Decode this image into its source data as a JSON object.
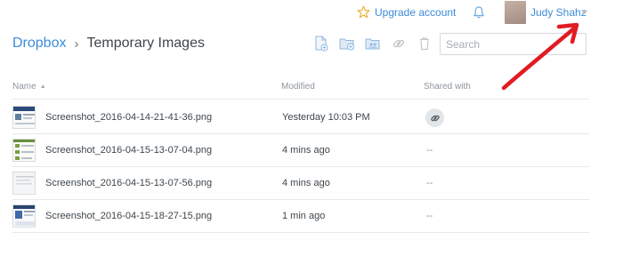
{
  "topbar": {
    "upgrade_label": "Upgrade account",
    "user_name": "Judy Shahz"
  },
  "breadcrumb": {
    "root": "Dropbox",
    "separator": "›",
    "current": "Temporary Images"
  },
  "toolbar": {
    "icons": [
      "new-file-icon",
      "new-folder-icon",
      "new-shared-folder-icon",
      "share-link-icon",
      "delete-icon"
    ]
  },
  "search": {
    "placeholder": "Search"
  },
  "table": {
    "columns": {
      "name": "Name",
      "modified": "Modified",
      "shared": "Shared with"
    },
    "rows": [
      {
        "name": "Screenshot_2016-04-14-21-41-36.png",
        "modified": "Yesterday 10:03 PM",
        "shared": ""
      },
      {
        "name": "Screenshot_2016-04-15-13-07-04.png",
        "modified": "4 mins ago",
        "shared": "--"
      },
      {
        "name": "Screenshot_2016-04-15-13-07-56.png",
        "modified": "4 mins ago",
        "shared": "--"
      },
      {
        "name": "Screenshot_2016-04-15-18-27-15.png",
        "modified": "1 min ago",
        "shared": "--"
      }
    ]
  },
  "colors": {
    "link": "#3d8bd8",
    "annotation_arrow": "#e11b22"
  }
}
